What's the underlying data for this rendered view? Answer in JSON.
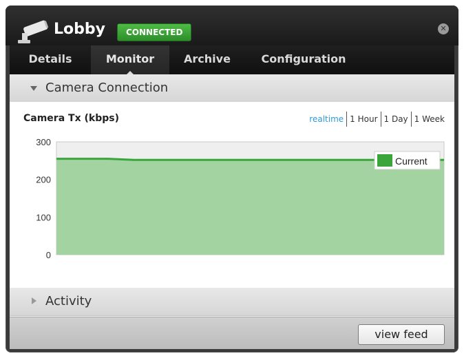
{
  "window": {
    "title": "Lobby",
    "status": "CONNECTED",
    "status_color": "#3aa53a"
  },
  "tabs": [
    {
      "label": "Details"
    },
    {
      "label": "Monitor",
      "active": true
    },
    {
      "label": "Archive"
    },
    {
      "label": "Configuration"
    }
  ],
  "sections": {
    "camera_connection": "Camera Connection",
    "activity": "Activity"
  },
  "chart_controls": {
    "ranges": [
      "realtime",
      "1 Hour",
      "1 Day",
      "1 Week"
    ],
    "active_range": "realtime"
  },
  "footer": {
    "view_feed_label": "view feed"
  },
  "chart_data": {
    "type": "area",
    "title": "Camera Tx (kbps)",
    "ylim": [
      0,
      300
    ],
    "yticks": [
      0,
      100,
      200,
      300
    ],
    "grid": true,
    "legend": "top-right",
    "series": [
      {
        "name": "Current",
        "color": "#3aa53a",
        "values": [
          255,
          255,
          255,
          252,
          252,
          252,
          252,
          252,
          252,
          252,
          252,
          252,
          252,
          252,
          252,
          252
        ]
      }
    ]
  }
}
